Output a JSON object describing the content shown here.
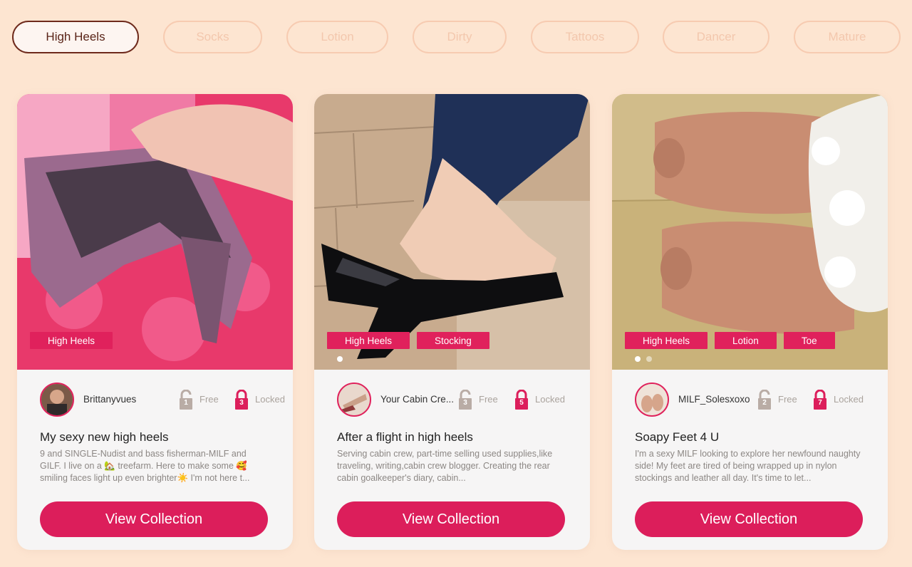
{
  "tabs": [
    {
      "label": "High Heels",
      "active": true
    },
    {
      "label": "Socks",
      "active": false
    },
    {
      "label": "Lotion",
      "active": false
    },
    {
      "label": "Dirty",
      "active": false
    },
    {
      "label": "Tattoos",
      "active": false
    },
    {
      "label": "Dancer",
      "active": false
    },
    {
      "label": "Mature",
      "active": false
    }
  ],
  "colors": {
    "background": "#fde5d1",
    "accent": "#dc1e5b",
    "tab_border": "#f7cbb1",
    "active_tab_border": "#6e2a1c"
  },
  "cards": [
    {
      "tags": [
        "High Heels"
      ],
      "username": "Brittanyvues",
      "free_count": "1",
      "free_label": "Free",
      "locked_count": "3",
      "locked_label": "Locked",
      "title": "My sexy new high heels",
      "description": "9 and SINGLE-Nudist and bass fisherman-MILF and GILF. I live on a 🏡 treefarm. Here to make some 🥰 smiling faces light up even brighter☀️ I'm not here t...",
      "button": "View Collection",
      "dots": 0
    },
    {
      "tags": [
        "High Heels",
        "Stocking"
      ],
      "username": "Your Cabin Cre...",
      "free_count": "3",
      "free_label": "Free",
      "locked_count": "5",
      "locked_label": "Locked",
      "title": "After a flight in high heels",
      "description": "Serving cabin crew, part-time selling used supplies,like traveling, writing,cabin crew blogger. Creating the rear cabin goalkeeper's diary, cabin...",
      "button": "View Collection",
      "dots": 1
    },
    {
      "tags": [
        "High Heels",
        "Lotion",
        "Toe"
      ],
      "username": "MILF_Solesxoxo",
      "free_count": "2",
      "free_label": "Free",
      "locked_count": "7",
      "locked_label": "Locked",
      "title": "Soapy Feet 4 U",
      "description": "I'm a sexy MILF looking to explore her newfound naughty side! My feet are tired of being wrapped up in nylon stockings and leather all day. It's time to let...",
      "button": "View Collection",
      "dots": 2
    }
  ]
}
